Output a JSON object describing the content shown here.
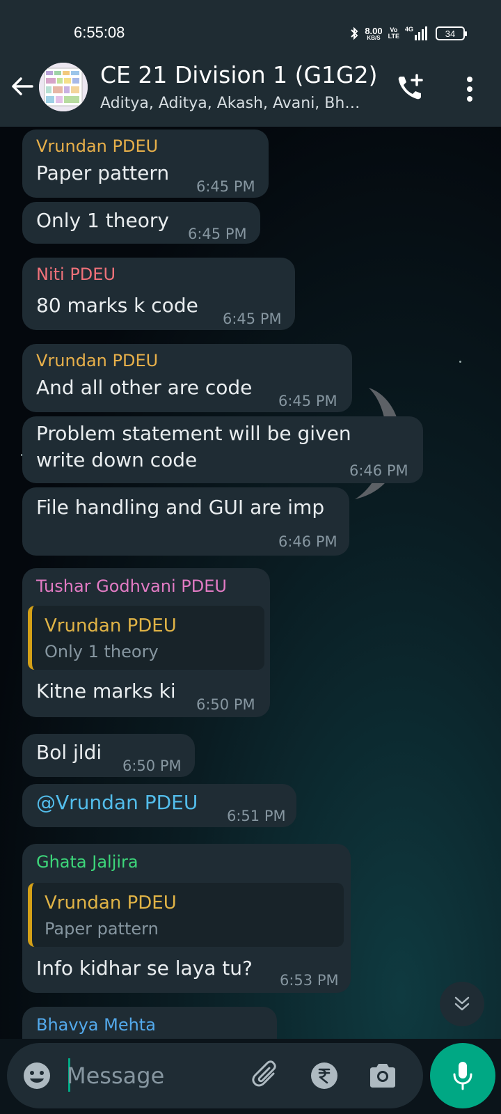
{
  "status_bar": {
    "time": "6:55:08",
    "net_speed_value": "8.00",
    "net_speed_unit": "KB/S",
    "volte_top": "Vo",
    "volte_bottom": "LTE",
    "network": "4G",
    "battery": "34"
  },
  "header": {
    "title": "CE 21 Division 1 (G1G2)",
    "members": "Aditya, Aditya, Akash, Avani, Bh…"
  },
  "messages": [
    {
      "sender": "Vrundan PDEU",
      "sender_color": "#e8b04a",
      "text": "Paper pattern",
      "time": "6:45 PM"
    },
    {
      "text": "Only 1 theory",
      "time": "6:45 PM"
    },
    {
      "sender": "Niti PDEU",
      "sender_color": "#f0727a",
      "text": "80 marks k code",
      "time": "6:45 PM"
    },
    {
      "sender": "Vrundan PDEU",
      "sender_color": "#e8b04a",
      "text": "And all other are code",
      "time": "6:45 PM"
    },
    {
      "text_line1": "Problem statement will be given",
      "text_line2": "write down code",
      "time": "6:46 PM"
    },
    {
      "text": "File handling and GUI are imp",
      "time": "6:46 PM"
    },
    {
      "sender": "Tushar Godhvani PDEU",
      "sender_color": "#e27bc4",
      "quote_name": "Vrundan PDEU",
      "quote_text": "Only 1 theory",
      "text": "Kitne marks ki",
      "time": "6:50 PM"
    },
    {
      "text": "Bol jldi",
      "time": "6:50 PM"
    },
    {
      "text": "@Vrundan PDEU",
      "text_color": "#53bdeb",
      "time": "6:51 PM"
    },
    {
      "sender": "Ghata Jaljira",
      "sender_color": "#3dd67a",
      "quote_name": "Vrundan PDEU",
      "quote_text": "Paper pattern",
      "text": "Info kidhar se laya tu?",
      "time": "6:53 PM"
    },
    {
      "sender": "Bhavya Mehta",
      "sender_color": "#53a9eb"
    }
  ],
  "composer": {
    "placeholder": "Message"
  },
  "colors": {
    "header_bg": "#1f2c33",
    "bubble_bg": "#1f2c34",
    "accent": "#00a884",
    "timestamp": "#8696a0"
  }
}
